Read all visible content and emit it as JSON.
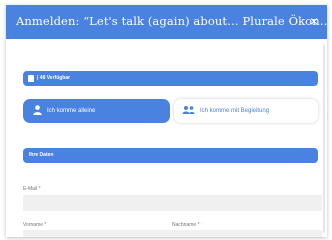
{
  "modal": {
    "title": "Anmelden: “Let's talk (again) about… Plurale Ökon…",
    "close_icon": "×"
  },
  "ticket": {
    "icon": "ticket-icon",
    "label": "| 48 Verfügbar"
  },
  "attendance_options": [
    {
      "label": "Ich komme alleine",
      "icon": "person-icon",
      "selected": true
    },
    {
      "label": "Ich komme mit Begleitung",
      "icon": "people-icon",
      "selected": false
    }
  ],
  "section": {
    "title": "Ihre Daten"
  },
  "fields": {
    "email": {
      "label": "E-Mail",
      "required_mark": "*",
      "value": ""
    },
    "first_name": {
      "label": "Vorname",
      "required_mark": "*",
      "value": ""
    },
    "last_name": {
      "label": "Nachname",
      "required_mark": "*",
      "value": ""
    }
  },
  "colors": {
    "accent": "#4a82e0",
    "input_bg": "#f0f0f0",
    "required": "#d9534f"
  }
}
